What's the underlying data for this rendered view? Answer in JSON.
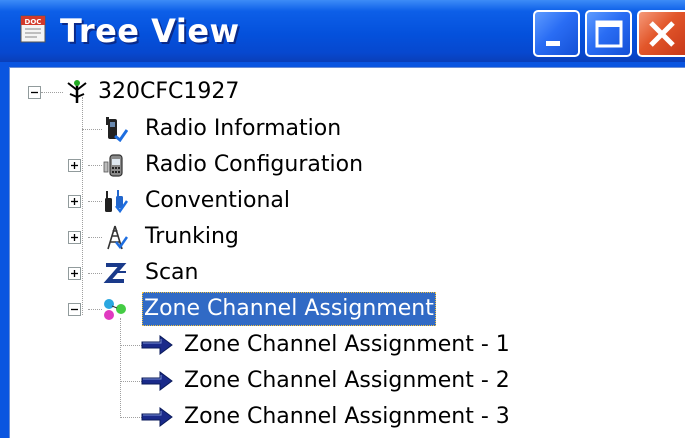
{
  "window": {
    "title": "Tree View",
    "title_icon": "doc-icon",
    "buttons": {
      "minimize": "minimize-icon",
      "maximize": "maximize-icon",
      "close": "close-icon"
    }
  },
  "tree": {
    "root": {
      "label": "320CFC1927",
      "expanded": true,
      "icon": "radio-tower-icon"
    },
    "items": [
      {
        "label": "Radio Information",
        "icon": "radio-info-icon",
        "expander": "none"
      },
      {
        "label": "Radio Configuration",
        "icon": "radio-config-icon",
        "expander": "plus"
      },
      {
        "label": "Conventional",
        "icon": "conventional-icon",
        "expander": "plus"
      },
      {
        "label": "Trunking",
        "icon": "trunking-icon",
        "expander": "plus"
      },
      {
        "label": "Scan",
        "icon": "scan-icon",
        "expander": "plus"
      },
      {
        "label": "Zone Channel Assignment",
        "icon": "zone-icon",
        "expander": "minus",
        "selected": true
      }
    ],
    "children": [
      {
        "label": "Zone Channel Assignment - 1",
        "icon": "arrow-right-icon"
      },
      {
        "label": "Zone Channel Assignment - 2",
        "icon": "arrow-right-icon"
      },
      {
        "label": "Zone Channel Assignment - 3",
        "icon": "arrow-right-icon"
      }
    ]
  },
  "colors": {
    "titlebar": "#0451dc",
    "selection": "#316ac5",
    "close_button": "#e2562a"
  }
}
